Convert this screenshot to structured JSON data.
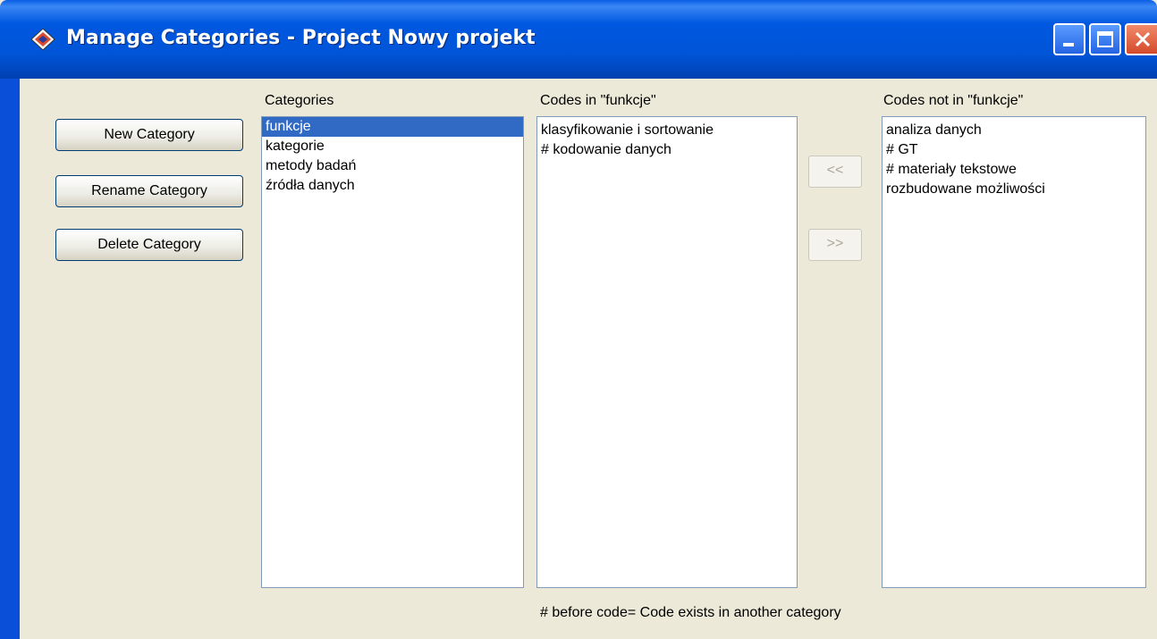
{
  "window": {
    "title": "Manage Categories - Project Nowy projekt"
  },
  "buttons": {
    "new_category": "New Category",
    "rename_category": "Rename Category",
    "delete_category": "Delete Category",
    "move_left": "<<",
    "move_right": ">>"
  },
  "categories": {
    "label": "Categories",
    "items": [
      "funkcje",
      "kategorie",
      "metody badań",
      "źródła danych"
    ],
    "selected": "funkcje"
  },
  "codes_in": {
    "label": "Codes in \"funkcje\"",
    "items": [
      "klasyfikowanie i sortowanie",
      "# kodowanie danych"
    ]
  },
  "codes_not_in": {
    "label": "Codes not in \"funkcje\"",
    "items": [
      "analiza danych",
      "# GT",
      "# materiały tekstowe",
      "rozbudowane możliwości"
    ]
  },
  "footer": {
    "note": "# before code= Code exists in another category"
  },
  "icons": {
    "app": "diamond-app-icon",
    "minimize": "minimize-icon",
    "maximize": "maximize-icon",
    "close": "close-icon"
  },
  "colors": {
    "titlebar": "#0054e3",
    "selection": "#316ac5",
    "face": "#ece9d8"
  }
}
